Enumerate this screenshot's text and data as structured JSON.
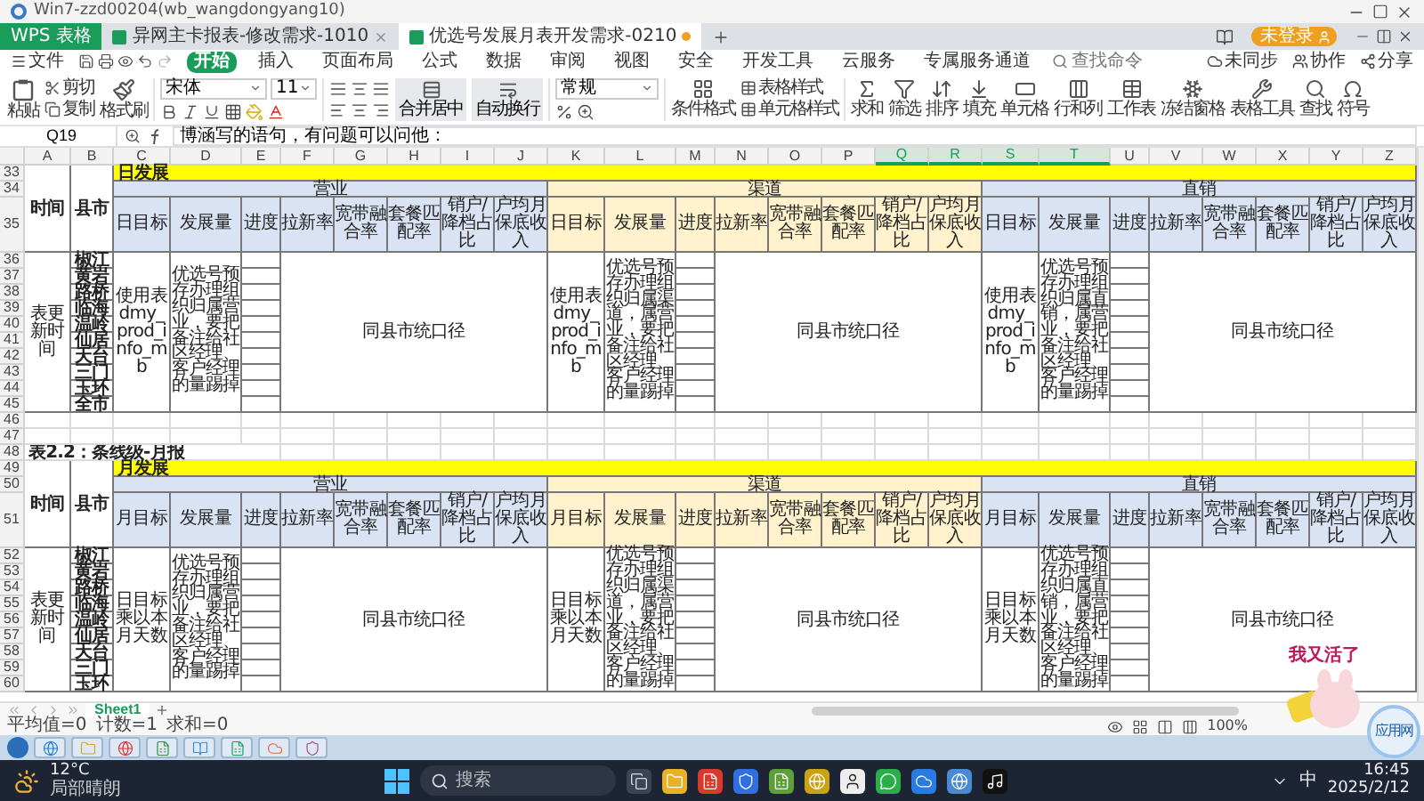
{
  "window": {
    "title": "Win7-zzd00204(wb_wangdongyang10)"
  },
  "tabs": [
    {
      "label": "WPS 表格",
      "kind": "home",
      "selected": false
    },
    {
      "label": "异网主卡报表-修改需求-1010",
      "kind": "doc",
      "selected": false
    },
    {
      "label": "优选号发展月表开发需求-0210",
      "kind": "doc",
      "selected": true
    }
  ],
  "account": "未登录",
  "file_menu": "文件",
  "menu": [
    {
      "label": "开始",
      "selected": true
    },
    {
      "label": "插入",
      "selected": false
    },
    {
      "label": "页面布局",
      "selected": false
    },
    {
      "label": "公式",
      "selected": false
    },
    {
      "label": "数据",
      "selected": false
    },
    {
      "label": "审阅",
      "selected": false
    },
    {
      "label": "视图",
      "selected": false
    },
    {
      "label": "安全",
      "selected": false
    },
    {
      "label": "开发工具",
      "selected": false
    },
    {
      "label": "云服务",
      "selected": false
    },
    {
      "label": "专属服务通道",
      "selected": false
    }
  ],
  "command_search": {
    "placeholder": "查找命令"
  },
  "actions": [
    "未同步",
    "协作",
    "分享"
  ],
  "ribbon": {
    "paste": "粘贴",
    "cut": "剪切",
    "copy": "复制",
    "painter": "格式刷",
    "font": "宋体",
    "size": "11",
    "merge": "合并居中",
    "wrap": "自动换行",
    "number_format": "常规",
    "style_menu": [
      "表格样式",
      "单元格样式"
    ],
    "tools": [
      "条件格式",
      "求和",
      "筛选",
      "排序",
      "填充",
      "单元格",
      "行和列",
      "工作表",
      "冻结窗格",
      "表格工具",
      "查找",
      "符号"
    ]
  },
  "formula_bar": {
    "cell": "Q19",
    "formula": "博涵写的语句，有问题可以问他："
  },
  "columns": [
    {
      "label": "A",
      "selected": false
    },
    {
      "label": "B",
      "selected": false
    },
    {
      "label": "C",
      "selected": false
    },
    {
      "label": "D",
      "selected": false
    },
    {
      "label": "E",
      "selected": false
    },
    {
      "label": "F",
      "selected": false
    },
    {
      "label": "G",
      "selected": false
    },
    {
      "label": "H",
      "selected": false
    },
    {
      "label": "I",
      "selected": false
    },
    {
      "label": "J",
      "selected": false
    },
    {
      "label": "K",
      "selected": false
    },
    {
      "label": "L",
      "selected": false
    },
    {
      "label": "M",
      "selected": false
    },
    {
      "label": "N",
      "selected": false
    },
    {
      "label": "O",
      "selected": false
    },
    {
      "label": "P",
      "selected": false
    },
    {
      "label": "Q",
      "selected": true
    },
    {
      "label": "R",
      "selected": true
    },
    {
      "label": "S",
      "selected": true
    },
    {
      "label": "T",
      "selected": true
    },
    {
      "label": "U",
      "selected": false
    },
    {
      "label": "V",
      "selected": false
    },
    {
      "label": "W",
      "selected": false
    },
    {
      "label": "X",
      "selected": false
    },
    {
      "label": "Y",
      "selected": false
    },
    {
      "label": "Z",
      "selected": false
    }
  ],
  "row_numbers": [
    "33",
    "34",
    "35",
    "36",
    "37",
    "38",
    "39",
    "40",
    "41",
    "42",
    "43",
    "44",
    "45",
    "46",
    "47",
    "48",
    "49",
    "50",
    "51",
    "52",
    "53",
    "54",
    "55",
    "56",
    "57",
    "58",
    "59",
    "60"
  ],
  "blocks": [
    {
      "kind": "section",
      "title": "日发展",
      "time_header": "时间",
      "city_header": "县市",
      "time_label": "表更新时间",
      "cities": [
        "椒江",
        "黄岩",
        "路桥",
        "临海",
        "温岭",
        "仙居",
        "天台",
        "三门",
        "玉环",
        "全市"
      ],
      "groups": [
        {
          "name": "营业",
          "color": "#dae3f3",
          "headers": [
            "日目标",
            "发展量",
            "进度",
            "拉新率",
            "宽带融合率",
            "套餐匹配率",
            "销户/降档占比",
            "户均月保底收入"
          ],
          "target": "使用表dmy_prod_info_mb",
          "volume": "优选号预存办理组织归属营业，要把备注给社区经理、客户经理的量踢掉",
          "caliber": "同县市统口径"
        },
        {
          "name": "渠道",
          "color": "#fff2cc",
          "headers": [
            "日目标",
            "发展量",
            "进度",
            "拉新率",
            "宽带融合率",
            "套餐匹配率",
            "销户/降档占比",
            "户均月保底收入"
          ],
          "target": "使用表dmy_prod_info_mb",
          "volume": "优选号预存办理组织归属渠道，属营业，要把备注给社区经理、客户经理的量踢掉",
          "caliber": "同县市统口径"
        },
        {
          "name": "直销",
          "color": "#dae3f3",
          "headers": [
            "日目标",
            "发展量",
            "进度",
            "拉新率",
            "宽带融合率",
            "套餐匹配率",
            "销户/降档占比",
            "户均月保底收入"
          ],
          "target": "使用表dmy_prod_info_mb",
          "volume": "优选号预存办理组织归属直销，属营业，要把备注给社区经理、客户经理的量踢掉",
          "caliber": "同县市统口径"
        }
      ]
    },
    {
      "kind": "blank"
    },
    {
      "kind": "blank"
    },
    {
      "kind": "caption",
      "text": "表2.2：条线级-月报"
    },
    {
      "kind": "section",
      "title": "月发展",
      "time_header": "时间",
      "city_header": "县市",
      "time_label": "表更新时间",
      "cities": [
        "椒江",
        "黄岩",
        "路桥",
        "临海",
        "温岭",
        "仙居",
        "天台",
        "三门",
        "玉环"
      ],
      "groups": [
        {
          "name": "营业",
          "color": "#dae3f3",
          "headers": [
            "月目标",
            "发展量",
            "进度",
            "拉新率",
            "宽带融合率",
            "套餐匹配率",
            "销户/降档占比",
            "户均月保底收入"
          ],
          "target": "日目标乘以本月天数",
          "volume": "优选号预存办理组织归属营业，要把备注给社区经理、客户经理的量踢掉",
          "caliber": "同县市统口径"
        },
        {
          "name": "渠道",
          "color": "#fff2cc",
          "headers": [
            "月目标",
            "发展量",
            "进度",
            "拉新率",
            "宽带融合率",
            "套餐匹配率",
            "销户/降档占比",
            "户均月保底收入"
          ],
          "target": "日目标乘以本月天数",
          "volume": "优选号预存办理组织归属渠道，属营业，要把备注给社区经理、客户经理的量踢掉",
          "caliber": "同县市统口径"
        },
        {
          "name": "直销",
          "color": "#dae3f3",
          "headers": [
            "月目标",
            "发展量",
            "进度",
            "拉新率",
            "宽带融合率",
            "套餐匹配率",
            "销户/降档占比",
            "户均月保底收入"
          ],
          "target": "日目标乘以本月天数",
          "volume": "优选号预存办理组织归属直销，属营业，要把备注给社区经理、客户经理的量踢掉",
          "caliber": "同县市统口径"
        }
      ]
    }
  ],
  "sheet_tabs": [
    {
      "label": "Sheet1",
      "selected": true
    }
  ],
  "status": {
    "stats": [
      "平均值=0",
      "计数=1",
      "求和=0"
    ],
    "zoom": "100%"
  },
  "sticker": {
    "text": "我又活了"
  },
  "floating_badge": "应用网",
  "taskbar": {
    "temperature": "12°C",
    "weather": "局部晴朗",
    "search": {
      "placeholder": "搜索"
    },
    "input_method": "中",
    "time": "16:45",
    "date": "2025/2/12"
  }
}
